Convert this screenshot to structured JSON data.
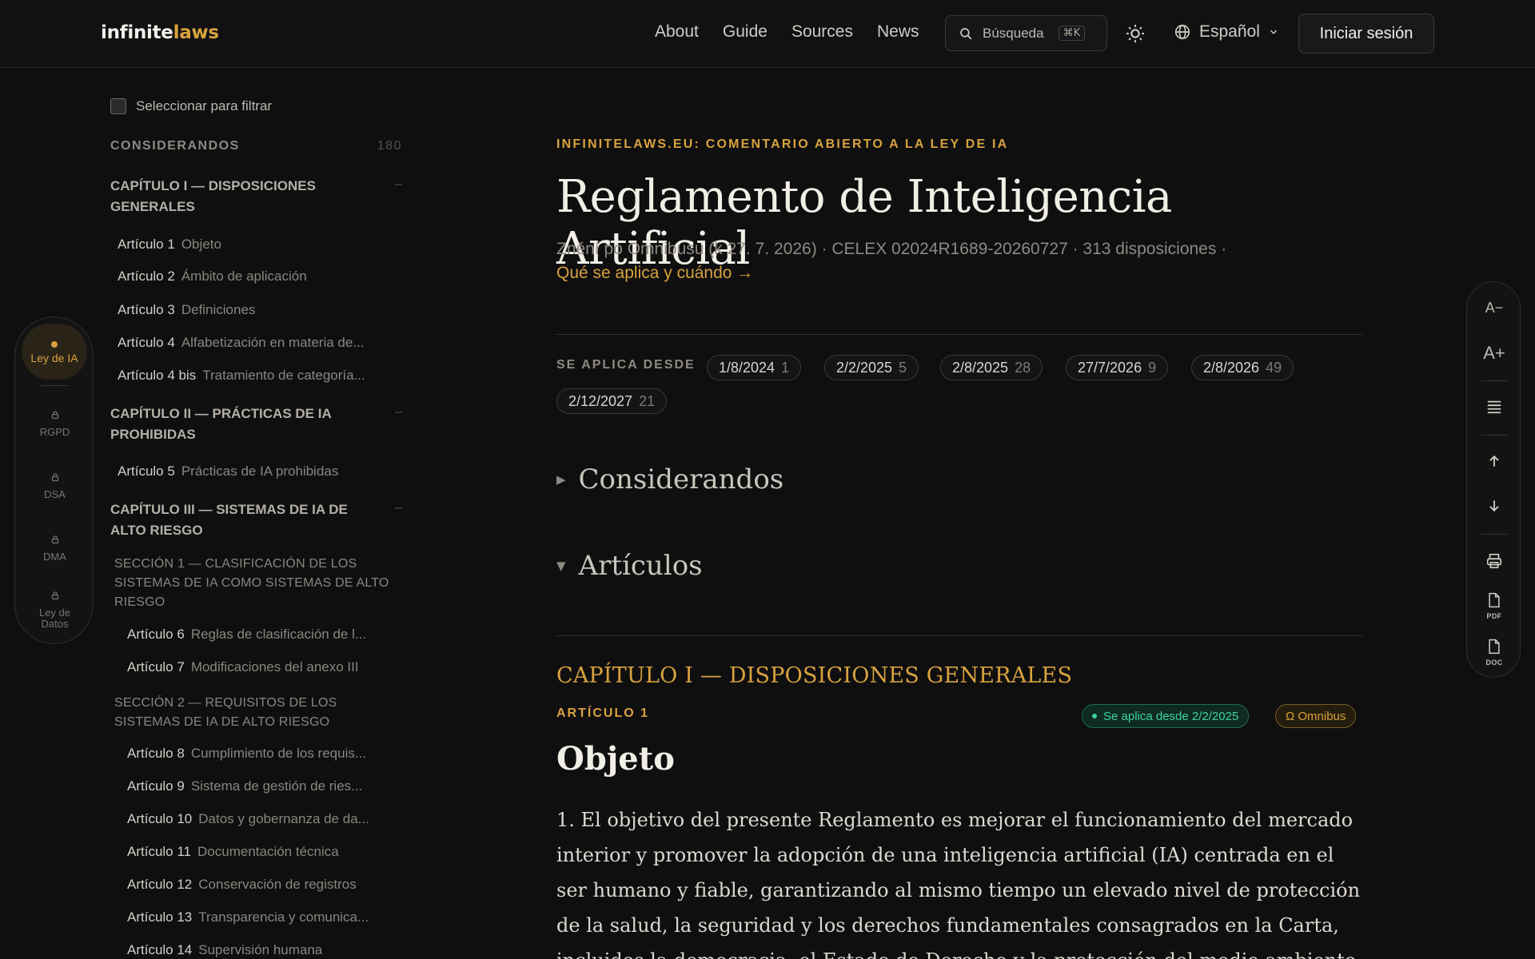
{
  "header": {
    "logo_a": "infinite",
    "logo_b": "laws",
    "nav": [
      "About",
      "Guide",
      "Sources",
      "News"
    ],
    "search_label": "Búsqueda",
    "search_shortcut": "⌘K",
    "language": "Español",
    "login": "Iniciar sesión"
  },
  "rail": {
    "active": "Ley de IA",
    "items": [
      "RGPD",
      "DSA",
      "DMA",
      "Ley de Datos"
    ]
  },
  "sidebar": {
    "filter_label": "Seleccionar para filtrar",
    "recitals_label": "CONSIDERANDOS",
    "recitals_count": "180",
    "toggle": "–",
    "chapters": [
      "CAPÍTULO I — DISPOSICIONES GENERALES",
      "CAPÍTULO II — PRÁCTICAS DE IA PROHIBIDAS",
      "CAPÍTULO III — SISTEMAS DE IA DE ALTO RIESGO"
    ],
    "sections": [
      "SECCIÓN 1 — CLASIFICACIÓN DE LOS SISTEMAS DE IA COMO SISTEMAS DE ALTO RIESGO",
      "SECCIÓN 2 — REQUISITOS DE LOS SISTEMAS DE IA DE ALTO RIESGO"
    ],
    "articles": [
      {
        "num": "Artículo 1",
        "title": "Objeto"
      },
      {
        "num": "Artículo 2",
        "title": "Ámbito de aplicación"
      },
      {
        "num": "Artículo 3",
        "title": "Definiciones"
      },
      {
        "num": "Artículo 4",
        "title": "Alfabetización en materia de..."
      },
      {
        "num": "Artículo 4 bis",
        "title": "Tratamiento de categoría..."
      },
      {
        "num": "Artículo 5",
        "title": "Prácticas de IA prohibidas"
      },
      {
        "num": "Artículo 6",
        "title": "Reglas de clasificación de l..."
      },
      {
        "num": "Artículo 7",
        "title": "Modificaciones del anexo III"
      },
      {
        "num": "Artículo 8",
        "title": "Cumplimiento de los requis..."
      },
      {
        "num": "Artículo 9",
        "title": "Sistema de gestión de ries..."
      },
      {
        "num": "Artículo 10",
        "title": "Datos y gobernanza de da..."
      },
      {
        "num": "Artículo 11",
        "title": "Documentación técnica"
      },
      {
        "num": "Artículo 12",
        "title": "Conservación de registros"
      },
      {
        "num": "Artículo 13",
        "title": "Transparencia y comunica..."
      },
      {
        "num": "Artículo 14",
        "title": "Supervisión humana"
      }
    ]
  },
  "main": {
    "eyebrow": "INFINITELAWS.EU: COMENTARIO ABIERTO A LA LEY DE IA",
    "title": "Reglamento de Inteligencia Artificial",
    "meta": "Znění po Omnibusu (k 27. 7. 2026) · CELEX 02024R1689-20260727 · 313 disposiciones ·",
    "meta_link": "Qué se aplica y cuándo →",
    "applies_label": "SE APLICA DESDE",
    "chips": [
      {
        "date": "1/8/2024",
        "n": "1"
      },
      {
        "date": "2/2/2025",
        "n": "5"
      },
      {
        "date": "2/8/2025",
        "n": "28"
      },
      {
        "date": "27/7/2026",
        "n": "9"
      },
      {
        "date": "2/8/2026",
        "n": "49"
      },
      {
        "date": "2/12/2027",
        "n": "21"
      }
    ],
    "recitals": "Considerandos",
    "articles": "Artículos",
    "arrow_collapsed": "▶",
    "arrow_expanded": "▼",
    "chapter_title": "CAPÍTULO I — DISPOSICIONES GENERALES",
    "article_label": "ARTÍCULO 1",
    "badge_applies": "Se aplica desde 2/2/2025",
    "badge_omnibus": "Ω Omnibus",
    "article_title": "Objeto",
    "paragraph": "1.  El objetivo del presente Reglamento es mejorar el funcionamiento del mercado interior y promover la adopción de una inteligencia artificial (IA) centrada en el ser humano y fiable, garantizando al mismo tiempo un elevado nivel de protección de la salud, la seguridad y los derechos fundamentales consagrados en la Carta, incluidos la democracia, el Estado de Derecho y la protección del medio ambiente"
  },
  "tools": {
    "font_smaller": "A−",
    "font_larger": "A+",
    "pdf": "PDF",
    "doc": "DOC"
  },
  "colors": {
    "accent": "#d8a23e",
    "background": "#0f0f10",
    "status_green": "#3ed3a0"
  }
}
